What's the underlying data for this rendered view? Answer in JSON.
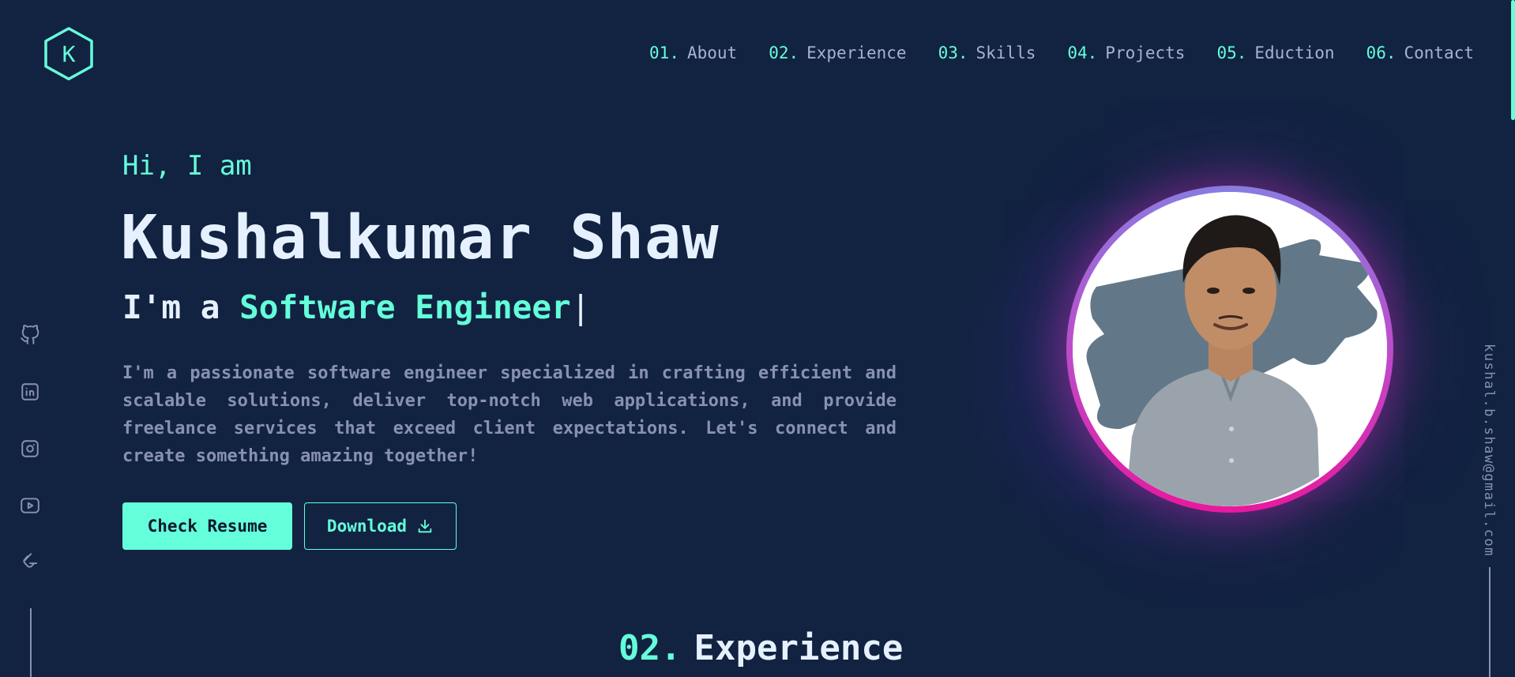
{
  "logo": {
    "letter": "K",
    "icon": "hexagon-logo-icon"
  },
  "nav": {
    "items": [
      {
        "num": "01.",
        "label": "About"
      },
      {
        "num": "02.",
        "label": "Experience"
      },
      {
        "num": "03.",
        "label": "Skills"
      },
      {
        "num": "04.",
        "label": "Projects"
      },
      {
        "num": "05.",
        "label": "Eduction"
      },
      {
        "num": "06.",
        "label": "Contact"
      }
    ]
  },
  "hero": {
    "greeting": "Hi, I am",
    "name": "Kushalkumar Shaw",
    "role_prefix": "I'm a ",
    "role_title": "Software Engineer",
    "caret": "|",
    "bio": "I'm a passionate software engineer specialized in crafting efficient and scalable solutions, deliver top-notch web applications, and provide freelance services that exceed client expectations. Let's connect and create something amazing together!",
    "primary_button": "Check Resume",
    "secondary_button": "Download"
  },
  "social": {
    "icons": [
      "github-icon",
      "linkedin-icon",
      "instagram-icon",
      "youtube-icon",
      "leetcode-icon"
    ]
  },
  "email": "kushal.b.shaw@gmail.com",
  "section": {
    "num": "02.",
    "title": "Experience"
  },
  "colors": {
    "background": "#122241",
    "accent": "#64ffda",
    "heading": "#e6f1ff",
    "muted": "#8892b0",
    "ring_top": "#8a7be0",
    "ring_bottom": "#e8199e"
  }
}
